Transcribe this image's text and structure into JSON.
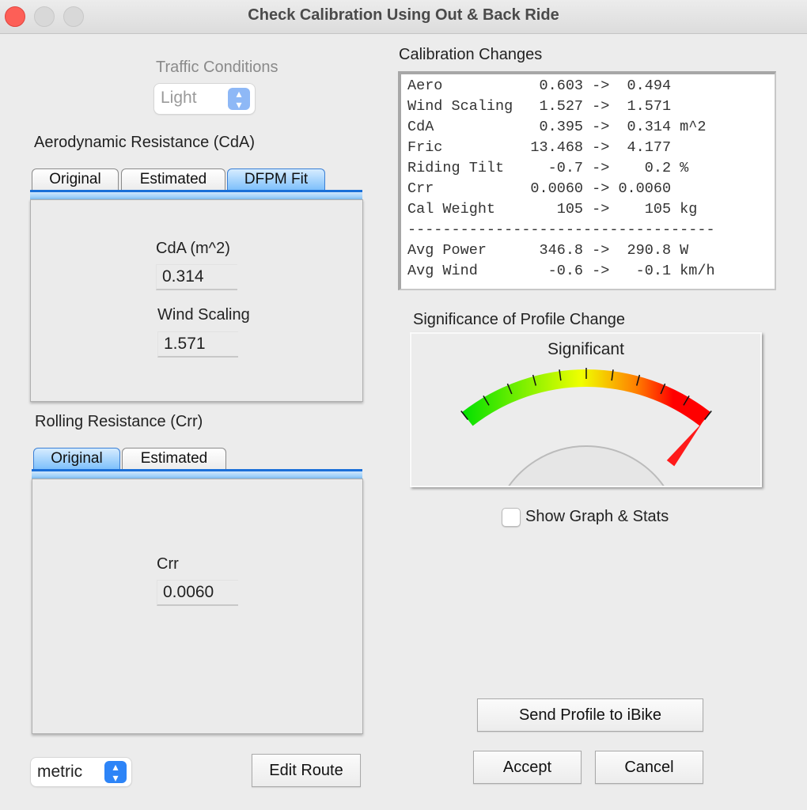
{
  "window": {
    "title": "Check Calibration Using Out & Back Ride"
  },
  "traffic": {
    "label": "Traffic Conditions",
    "value": "Light"
  },
  "aero_section": {
    "label": "Aerodynamic Resistance (CdA)",
    "tabs": [
      {
        "label": "Original",
        "active": false
      },
      {
        "label": "Estimated",
        "active": false
      },
      {
        "label": "DFPM Fit",
        "active": true
      }
    ],
    "cda_label": "CdA (m^2)",
    "cda_value": "0.314",
    "wind_label": "Wind Scaling",
    "wind_value": "1.571"
  },
  "rolling_section": {
    "label": "Rolling Resistance (Crr)",
    "tabs": [
      {
        "label": "Original",
        "active": true
      },
      {
        "label": "Estimated",
        "active": false
      }
    ],
    "crr_label": "Crr",
    "crr_value": "0.0060"
  },
  "units": {
    "value": "metric"
  },
  "buttons": {
    "edit_route": "Edit Route",
    "send_profile": "Send Profile to iBike",
    "accept": "Accept",
    "cancel": "Cancel"
  },
  "calibration": {
    "title": "Calibration Changes",
    "rows": [
      {
        "name": "Aero",
        "from": "0.603",
        "to": "0.494",
        "unit": ""
      },
      {
        "name": "Wind Scaling",
        "from": "1.527",
        "to": "1.571",
        "unit": ""
      },
      {
        "name": "CdA",
        "from": "0.395",
        "to": "0.314",
        "unit": "m^2"
      },
      {
        "name": "Fric",
        "from": "13.468",
        "to": "4.177",
        "unit": ""
      },
      {
        "name": "Riding Tilt",
        "from": "-0.7",
        "to": "0.2",
        "unit": "%"
      },
      {
        "name": "Crr",
        "from": "0.0060",
        "to": "0.0060",
        "unit": ""
      },
      {
        "name": "Cal Weight",
        "from": "105",
        "to": "105",
        "unit": "kg"
      }
    ],
    "separator": "-----------------------------------",
    "summary_rows": [
      {
        "name": "Avg Power",
        "from": "346.8",
        "to": "290.8",
        "unit": "W"
      },
      {
        "name": "Avg Wind",
        "from": "-0.6",
        "to": "-0.1",
        "unit": "km/h"
      }
    ],
    "arrow": "->"
  },
  "significance": {
    "title": "Significance of Profile Change",
    "status": "Significant",
    "level_fraction": 1.0,
    "colors": {
      "low": "#00e000",
      "mid": "#f0ff00",
      "high": "#ff0000",
      "needle": "#ff1a1a"
    }
  },
  "show_graph": {
    "label": "Show Graph & Stats",
    "checked": false
  }
}
